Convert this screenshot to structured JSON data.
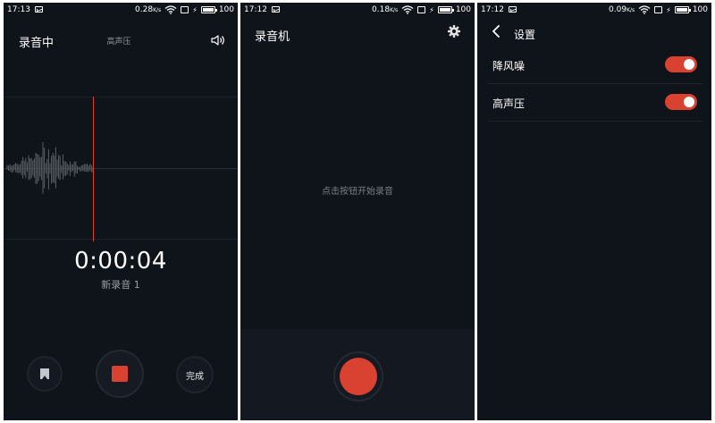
{
  "screens": [
    {
      "status": {
        "time": "17:13",
        "speed": "0.28",
        "speed_unit": "K/s",
        "battery": "100"
      },
      "title": "录音中",
      "mode_label": "高声压",
      "timer": "0:00:04",
      "recording_name": "新录音 1",
      "done_label": "完成"
    },
    {
      "status": {
        "time": "17:12",
        "speed": "0.18",
        "speed_unit": "K/s",
        "battery": "100"
      },
      "title": "录音机",
      "hint": "点击按钮开始录音"
    },
    {
      "status": {
        "time": "17:12",
        "speed": "0.09",
        "speed_unit": "K/s",
        "battery": "100"
      },
      "title": "设置",
      "settings": [
        {
          "label": "降风噪",
          "enabled": true
        },
        {
          "label": "高声压",
          "enabled": true
        }
      ]
    }
  ],
  "colors": {
    "background": "#0f131a",
    "accent": "#d94130",
    "text": "#ffffff",
    "muted": "#8f9399"
  },
  "icons": {
    "speaker": "speaker-icon",
    "gear": "gear-icon",
    "back": "back-chevron-icon",
    "bookmark": "bookmark-icon"
  }
}
